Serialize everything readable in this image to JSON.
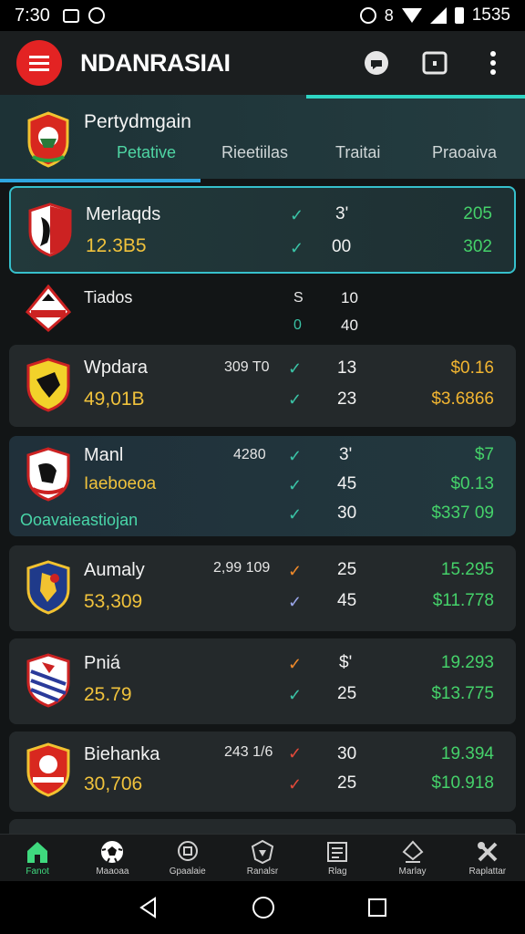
{
  "status": {
    "time": "7:30",
    "clock": "1535"
  },
  "app": {
    "title": "NDANRASIAI"
  },
  "section": {
    "title": "Pertydmgain",
    "tabs": [
      "Petative",
      "Rieetiilas",
      "Traitai",
      "Praoaiva"
    ],
    "active_tab": 0
  },
  "rows": [
    {
      "name": "Merlaqds",
      "sub": "12.3B5",
      "mid": "",
      "checks": [
        "✓",
        "✓"
      ],
      "nums": [
        "3'",
        "00"
      ],
      "vals": [
        "205",
        "302"
      ],
      "footnote": ""
    },
    {
      "name": "Tiados",
      "sub": "",
      "mid": "",
      "checks": [
        "S",
        "0"
      ],
      "nums": [
        "10",
        "40"
      ],
      "vals": [
        "",
        ""
      ],
      "footnote": ""
    },
    {
      "name": "Wpdara",
      "sub": "49,01B",
      "mid": "309 T0",
      "checks": [
        "✓",
        "✓"
      ],
      "nums": [
        "13",
        "23"
      ],
      "vals": [
        "$0.16",
        "$3.6866"
      ],
      "footnote": ""
    },
    {
      "name": "Manl",
      "sub": "Iaeboeoa",
      "mid": "4280",
      "checks": [
        "✓",
        "✓",
        "✓"
      ],
      "nums": [
        "3'",
        "45",
        "30"
      ],
      "vals": [
        "$7",
        "$0.13",
        "$337 09"
      ],
      "footnote": "Ooavaieastiojan"
    },
    {
      "name": "Aumaly",
      "sub": "53,309",
      "mid": "2,99 109",
      "checks": [
        "✓",
        "✓"
      ],
      "nums": [
        "25",
        "45"
      ],
      "vals": [
        "15.295",
        "$11.778"
      ],
      "footnote": ""
    },
    {
      "name": "Pniá",
      "sub": "25.79",
      "mid": "",
      "checks": [
        "✓",
        "✓"
      ],
      "nums": [
        "$'",
        "25"
      ],
      "vals": [
        "19.293",
        "$13.775"
      ],
      "footnote": ""
    },
    {
      "name": "Biehanka",
      "sub": "30,706",
      "mid": "243 1/6",
      "checks": [
        "✓",
        "✓"
      ],
      "nums": [
        "30",
        "25"
      ],
      "vals": [
        "19.394",
        "$10.918"
      ],
      "footnote": ""
    }
  ],
  "bottom_nav": [
    {
      "label": "Fanot",
      "icon": "home-icon"
    },
    {
      "label": "Maaoaa",
      "icon": "soccer-ball-icon"
    },
    {
      "label": "Gpaalaie",
      "icon": "trophy-icon"
    },
    {
      "label": "Ranalsr",
      "icon": "shield-icon"
    },
    {
      "label": "Rlag",
      "icon": "clipboard-icon"
    },
    {
      "label": "Marlay",
      "icon": "stadium-icon"
    },
    {
      "label": "Raplattar",
      "icon": "tools-icon"
    }
  ],
  "colors": {
    "accent": "#2ed6c4",
    "brand": "#e32323",
    "positive": "#45d26a",
    "gold": "#f2b531"
  }
}
